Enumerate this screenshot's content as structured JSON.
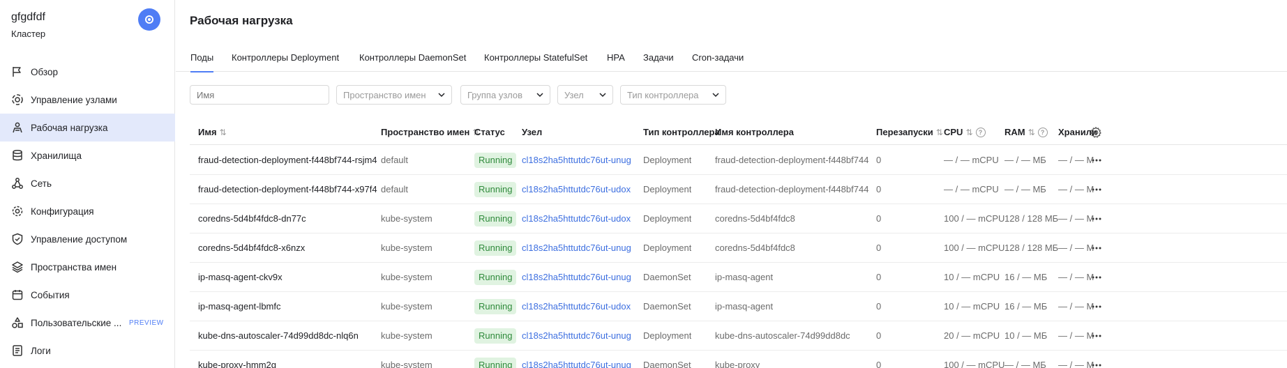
{
  "sidebar": {
    "title": "gfgdfdf",
    "subtitle": "Кластер",
    "toggle_icon": "collapse-circle-icon",
    "items": [
      {
        "label": "Обзор",
        "icon": "flag-icon"
      },
      {
        "label": "Управление узлами",
        "icon": "nodes-icon"
      },
      {
        "label": "Рабочая нагрузка",
        "icon": "workload-icon",
        "active": true
      },
      {
        "label": "Хранилища",
        "icon": "database-icon"
      },
      {
        "label": "Сеть",
        "icon": "network-icon"
      },
      {
        "label": "Конфигурация",
        "icon": "gear-icon"
      },
      {
        "label": "Управление доступом",
        "icon": "shield-icon"
      },
      {
        "label": "Пространства имен",
        "icon": "layers-icon"
      },
      {
        "label": "События",
        "icon": "calendar-icon"
      },
      {
        "label": "Пользовательские ...",
        "icon": "shapes-icon",
        "badge": "PREVIEW"
      },
      {
        "label": "Логи",
        "icon": "logs-icon"
      }
    ]
  },
  "main": {
    "title": "Рабочая нагрузка",
    "tabs": [
      {
        "label": "Поды",
        "active": true
      },
      {
        "label": "Контроллеры Deployment"
      },
      {
        "label": "Контроллеры DaemonSet"
      },
      {
        "label": "Контроллеры StatefulSet"
      },
      {
        "label": "HPA"
      },
      {
        "label": "Задачи"
      },
      {
        "label": "Cron-задачи"
      }
    ],
    "filters": {
      "name_placeholder": "Имя",
      "namespace": "Пространство имен",
      "node_group": "Группа узлов",
      "node": "Узел",
      "controller_type": "Тип контроллера"
    },
    "table": {
      "headers": {
        "name": "Имя",
        "namespace": "Пространство имен",
        "status": "Статус",
        "node": "Узел",
        "ctrl_type": "Тип контроллера",
        "ctrl_name": "Имя контроллера",
        "restarts": "Перезапуски",
        "cpu": "CPU",
        "ram": "RAM",
        "storage": "Хранилищ"
      },
      "rows": [
        {
          "name": "fraud-detection-deployment-f448bf744-rsjm4",
          "ns": "default",
          "status": "Running",
          "node": "cl18s2ha5httutdc76ut-unug",
          "ctype": "Deployment",
          "cname": "fraud-detection-deployment-f448bf744",
          "restarts": "0",
          "cpu": "— / — mCPU",
          "ram": "— / — МБ",
          "storage": "— / — МБ"
        },
        {
          "name": "fraud-detection-deployment-f448bf744-x97f4",
          "ns": "default",
          "status": "Running",
          "node": "cl18s2ha5httutdc76ut-udox",
          "ctype": "Deployment",
          "cname": "fraud-detection-deployment-f448bf744",
          "restarts": "0",
          "cpu": "— / — mCPU",
          "ram": "— / — МБ",
          "storage": "— / — МБ"
        },
        {
          "name": "coredns-5d4bf4fdc8-dn77c",
          "ns": "kube-system",
          "status": "Running",
          "node": "cl18s2ha5httutdc76ut-udox",
          "ctype": "Deployment",
          "cname": "coredns-5d4bf4fdc8",
          "restarts": "0",
          "cpu": "100 / — mCPU",
          "ram": "128 / 128 МБ",
          "storage": "— / — МБ"
        },
        {
          "name": "coredns-5d4bf4fdc8-x6nzx",
          "ns": "kube-system",
          "status": "Running",
          "node": "cl18s2ha5httutdc76ut-unug",
          "ctype": "Deployment",
          "cname": "coredns-5d4bf4fdc8",
          "restarts": "0",
          "cpu": "100 / — mCPU",
          "ram": "128 / 128 МБ",
          "storage": "— / — МБ"
        },
        {
          "name": "ip-masq-agent-ckv9x",
          "ns": "kube-system",
          "status": "Running",
          "node": "cl18s2ha5httutdc76ut-unug",
          "ctype": "DaemonSet",
          "cname": "ip-masq-agent",
          "restarts": "0",
          "cpu": "10 / — mCPU",
          "ram": "16 / — МБ",
          "storage": "— / — МБ"
        },
        {
          "name": "ip-masq-agent-lbmfc",
          "ns": "kube-system",
          "status": "Running",
          "node": "cl18s2ha5httutdc76ut-udox",
          "ctype": "DaemonSet",
          "cname": "ip-masq-agent",
          "restarts": "0",
          "cpu": "10 / — mCPU",
          "ram": "16 / — МБ",
          "storage": "— / — МБ"
        },
        {
          "name": "kube-dns-autoscaler-74d99dd8dc-nlq6n",
          "ns": "kube-system",
          "status": "Running",
          "node": "cl18s2ha5httutdc76ut-unug",
          "ctype": "Deployment",
          "cname": "kube-dns-autoscaler-74d99dd8dc",
          "restarts": "0",
          "cpu": "20 / — mCPU",
          "ram": "10 / — МБ",
          "storage": "— / — МБ"
        },
        {
          "name": "kube-proxy-hmm2g",
          "ns": "kube-system",
          "status": "Running",
          "node": "cl18s2ha5httutdc76ut-unug",
          "ctype": "DaemonSet",
          "cname": "kube-proxy",
          "restarts": "0",
          "cpu": "100 / — mCPU",
          "ram": "— / — МБ",
          "storage": "— / — МБ"
        }
      ]
    }
  },
  "colors": {
    "accent": "#4f7df5",
    "active_nav": "#e3e9fb",
    "status_bg": "#e0f3e1",
    "status_text": "#2f8a3b",
    "link": "#3d6fe0"
  }
}
